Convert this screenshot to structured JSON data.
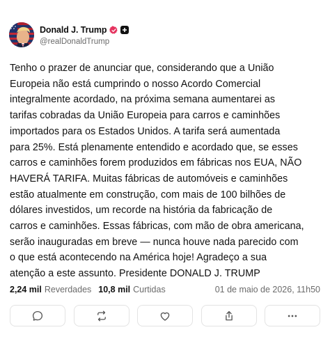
{
  "author": {
    "display_name": "Donald J. Trump",
    "handle": "@realDonaldTrump",
    "avatar_icon": "trump-avatar",
    "verified_icon": "verified-badge-icon",
    "verified_color": "#e5335f",
    "plus_icon": "plus-badge-icon"
  },
  "post": {
    "text": "Tenho o prazer de anunciar que, considerando que a União\nEuropeia não está cumprindo o nosso Acordo Comercial\nintegralmente acordado, na próxima semana aumentarei as\ntarifas cobradas da União Europeia para carros e caminhões\nimportados para os Estados Unidos. A tarifa será aumentada\npara 25%. Está plenamente entendido e acordado que, se esses\ncarros e caminhões forem produzidos em fábricas nos EUA, NÃO\nHAVERÁ TARIFA. Muitas fábricas de automóveis e caminhões\nestão atualmente em construção, com mais de 100 bilhões de\ndólares investidos, um recorde na história da fabricação de\ncarros e caminhões. Essas fábricas, com mão de obra americana,\nserão inauguradas em breve — nunca houve nada parecido com\no que está acontecendo na América hoje! Agradeço a sua\natenção a este assunto. Presidente DONALD J. TRUMP"
  },
  "stats": {
    "reposts_count": "2,24 mil",
    "reposts_label": "Reverdades",
    "likes_count": "10,8 mil",
    "likes_label": "Curtidas",
    "timestamp": "01 de maio de 2026, 11h50"
  },
  "actions": [
    {
      "name": "reply-button",
      "icon": "comment-icon"
    },
    {
      "name": "repost-button",
      "icon": "repost-icon"
    },
    {
      "name": "like-button",
      "icon": "heart-icon"
    },
    {
      "name": "share-button",
      "icon": "share-icon"
    },
    {
      "name": "more-button",
      "icon": "more-icon"
    }
  ]
}
